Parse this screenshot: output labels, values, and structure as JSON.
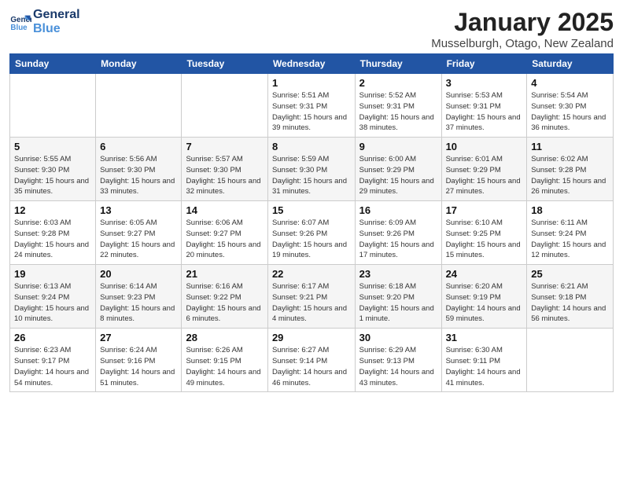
{
  "header": {
    "logo_line1": "General",
    "logo_line2": "Blue",
    "title": "January 2025",
    "location": "Musselburgh, Otago, New Zealand"
  },
  "weekdays": [
    "Sunday",
    "Monday",
    "Tuesday",
    "Wednesday",
    "Thursday",
    "Friday",
    "Saturday"
  ],
  "weeks": [
    [
      {
        "day": "",
        "info": ""
      },
      {
        "day": "",
        "info": ""
      },
      {
        "day": "",
        "info": ""
      },
      {
        "day": "1",
        "info": "Sunrise: 5:51 AM\nSunset: 9:31 PM\nDaylight: 15 hours\nand 39 minutes."
      },
      {
        "day": "2",
        "info": "Sunrise: 5:52 AM\nSunset: 9:31 PM\nDaylight: 15 hours\nand 38 minutes."
      },
      {
        "day": "3",
        "info": "Sunrise: 5:53 AM\nSunset: 9:31 PM\nDaylight: 15 hours\nand 37 minutes."
      },
      {
        "day": "4",
        "info": "Sunrise: 5:54 AM\nSunset: 9:30 PM\nDaylight: 15 hours\nand 36 minutes."
      }
    ],
    [
      {
        "day": "5",
        "info": "Sunrise: 5:55 AM\nSunset: 9:30 PM\nDaylight: 15 hours\nand 35 minutes."
      },
      {
        "day": "6",
        "info": "Sunrise: 5:56 AM\nSunset: 9:30 PM\nDaylight: 15 hours\nand 33 minutes."
      },
      {
        "day": "7",
        "info": "Sunrise: 5:57 AM\nSunset: 9:30 PM\nDaylight: 15 hours\nand 32 minutes."
      },
      {
        "day": "8",
        "info": "Sunrise: 5:59 AM\nSunset: 9:30 PM\nDaylight: 15 hours\nand 31 minutes."
      },
      {
        "day": "9",
        "info": "Sunrise: 6:00 AM\nSunset: 9:29 PM\nDaylight: 15 hours\nand 29 minutes."
      },
      {
        "day": "10",
        "info": "Sunrise: 6:01 AM\nSunset: 9:29 PM\nDaylight: 15 hours\nand 27 minutes."
      },
      {
        "day": "11",
        "info": "Sunrise: 6:02 AM\nSunset: 9:28 PM\nDaylight: 15 hours\nand 26 minutes."
      }
    ],
    [
      {
        "day": "12",
        "info": "Sunrise: 6:03 AM\nSunset: 9:28 PM\nDaylight: 15 hours\nand 24 minutes."
      },
      {
        "day": "13",
        "info": "Sunrise: 6:05 AM\nSunset: 9:27 PM\nDaylight: 15 hours\nand 22 minutes."
      },
      {
        "day": "14",
        "info": "Sunrise: 6:06 AM\nSunset: 9:27 PM\nDaylight: 15 hours\nand 20 minutes."
      },
      {
        "day": "15",
        "info": "Sunrise: 6:07 AM\nSunset: 9:26 PM\nDaylight: 15 hours\nand 19 minutes."
      },
      {
        "day": "16",
        "info": "Sunrise: 6:09 AM\nSunset: 9:26 PM\nDaylight: 15 hours\nand 17 minutes."
      },
      {
        "day": "17",
        "info": "Sunrise: 6:10 AM\nSunset: 9:25 PM\nDaylight: 15 hours\nand 15 minutes."
      },
      {
        "day": "18",
        "info": "Sunrise: 6:11 AM\nSunset: 9:24 PM\nDaylight: 15 hours\nand 12 minutes."
      }
    ],
    [
      {
        "day": "19",
        "info": "Sunrise: 6:13 AM\nSunset: 9:24 PM\nDaylight: 15 hours\nand 10 minutes."
      },
      {
        "day": "20",
        "info": "Sunrise: 6:14 AM\nSunset: 9:23 PM\nDaylight: 15 hours\nand 8 minutes."
      },
      {
        "day": "21",
        "info": "Sunrise: 6:16 AM\nSunset: 9:22 PM\nDaylight: 15 hours\nand 6 minutes."
      },
      {
        "day": "22",
        "info": "Sunrise: 6:17 AM\nSunset: 9:21 PM\nDaylight: 15 hours\nand 4 minutes."
      },
      {
        "day": "23",
        "info": "Sunrise: 6:18 AM\nSunset: 9:20 PM\nDaylight: 15 hours\nand 1 minute."
      },
      {
        "day": "24",
        "info": "Sunrise: 6:20 AM\nSunset: 9:19 PM\nDaylight: 14 hours\nand 59 minutes."
      },
      {
        "day": "25",
        "info": "Sunrise: 6:21 AM\nSunset: 9:18 PM\nDaylight: 14 hours\nand 56 minutes."
      }
    ],
    [
      {
        "day": "26",
        "info": "Sunrise: 6:23 AM\nSunset: 9:17 PM\nDaylight: 14 hours\nand 54 minutes."
      },
      {
        "day": "27",
        "info": "Sunrise: 6:24 AM\nSunset: 9:16 PM\nDaylight: 14 hours\nand 51 minutes."
      },
      {
        "day": "28",
        "info": "Sunrise: 6:26 AM\nSunset: 9:15 PM\nDaylight: 14 hours\nand 49 minutes."
      },
      {
        "day": "29",
        "info": "Sunrise: 6:27 AM\nSunset: 9:14 PM\nDaylight: 14 hours\nand 46 minutes."
      },
      {
        "day": "30",
        "info": "Sunrise: 6:29 AM\nSunset: 9:13 PM\nDaylight: 14 hours\nand 43 minutes."
      },
      {
        "day": "31",
        "info": "Sunrise: 6:30 AM\nSunset: 9:11 PM\nDaylight: 14 hours\nand 41 minutes."
      },
      {
        "day": "",
        "info": ""
      }
    ]
  ]
}
